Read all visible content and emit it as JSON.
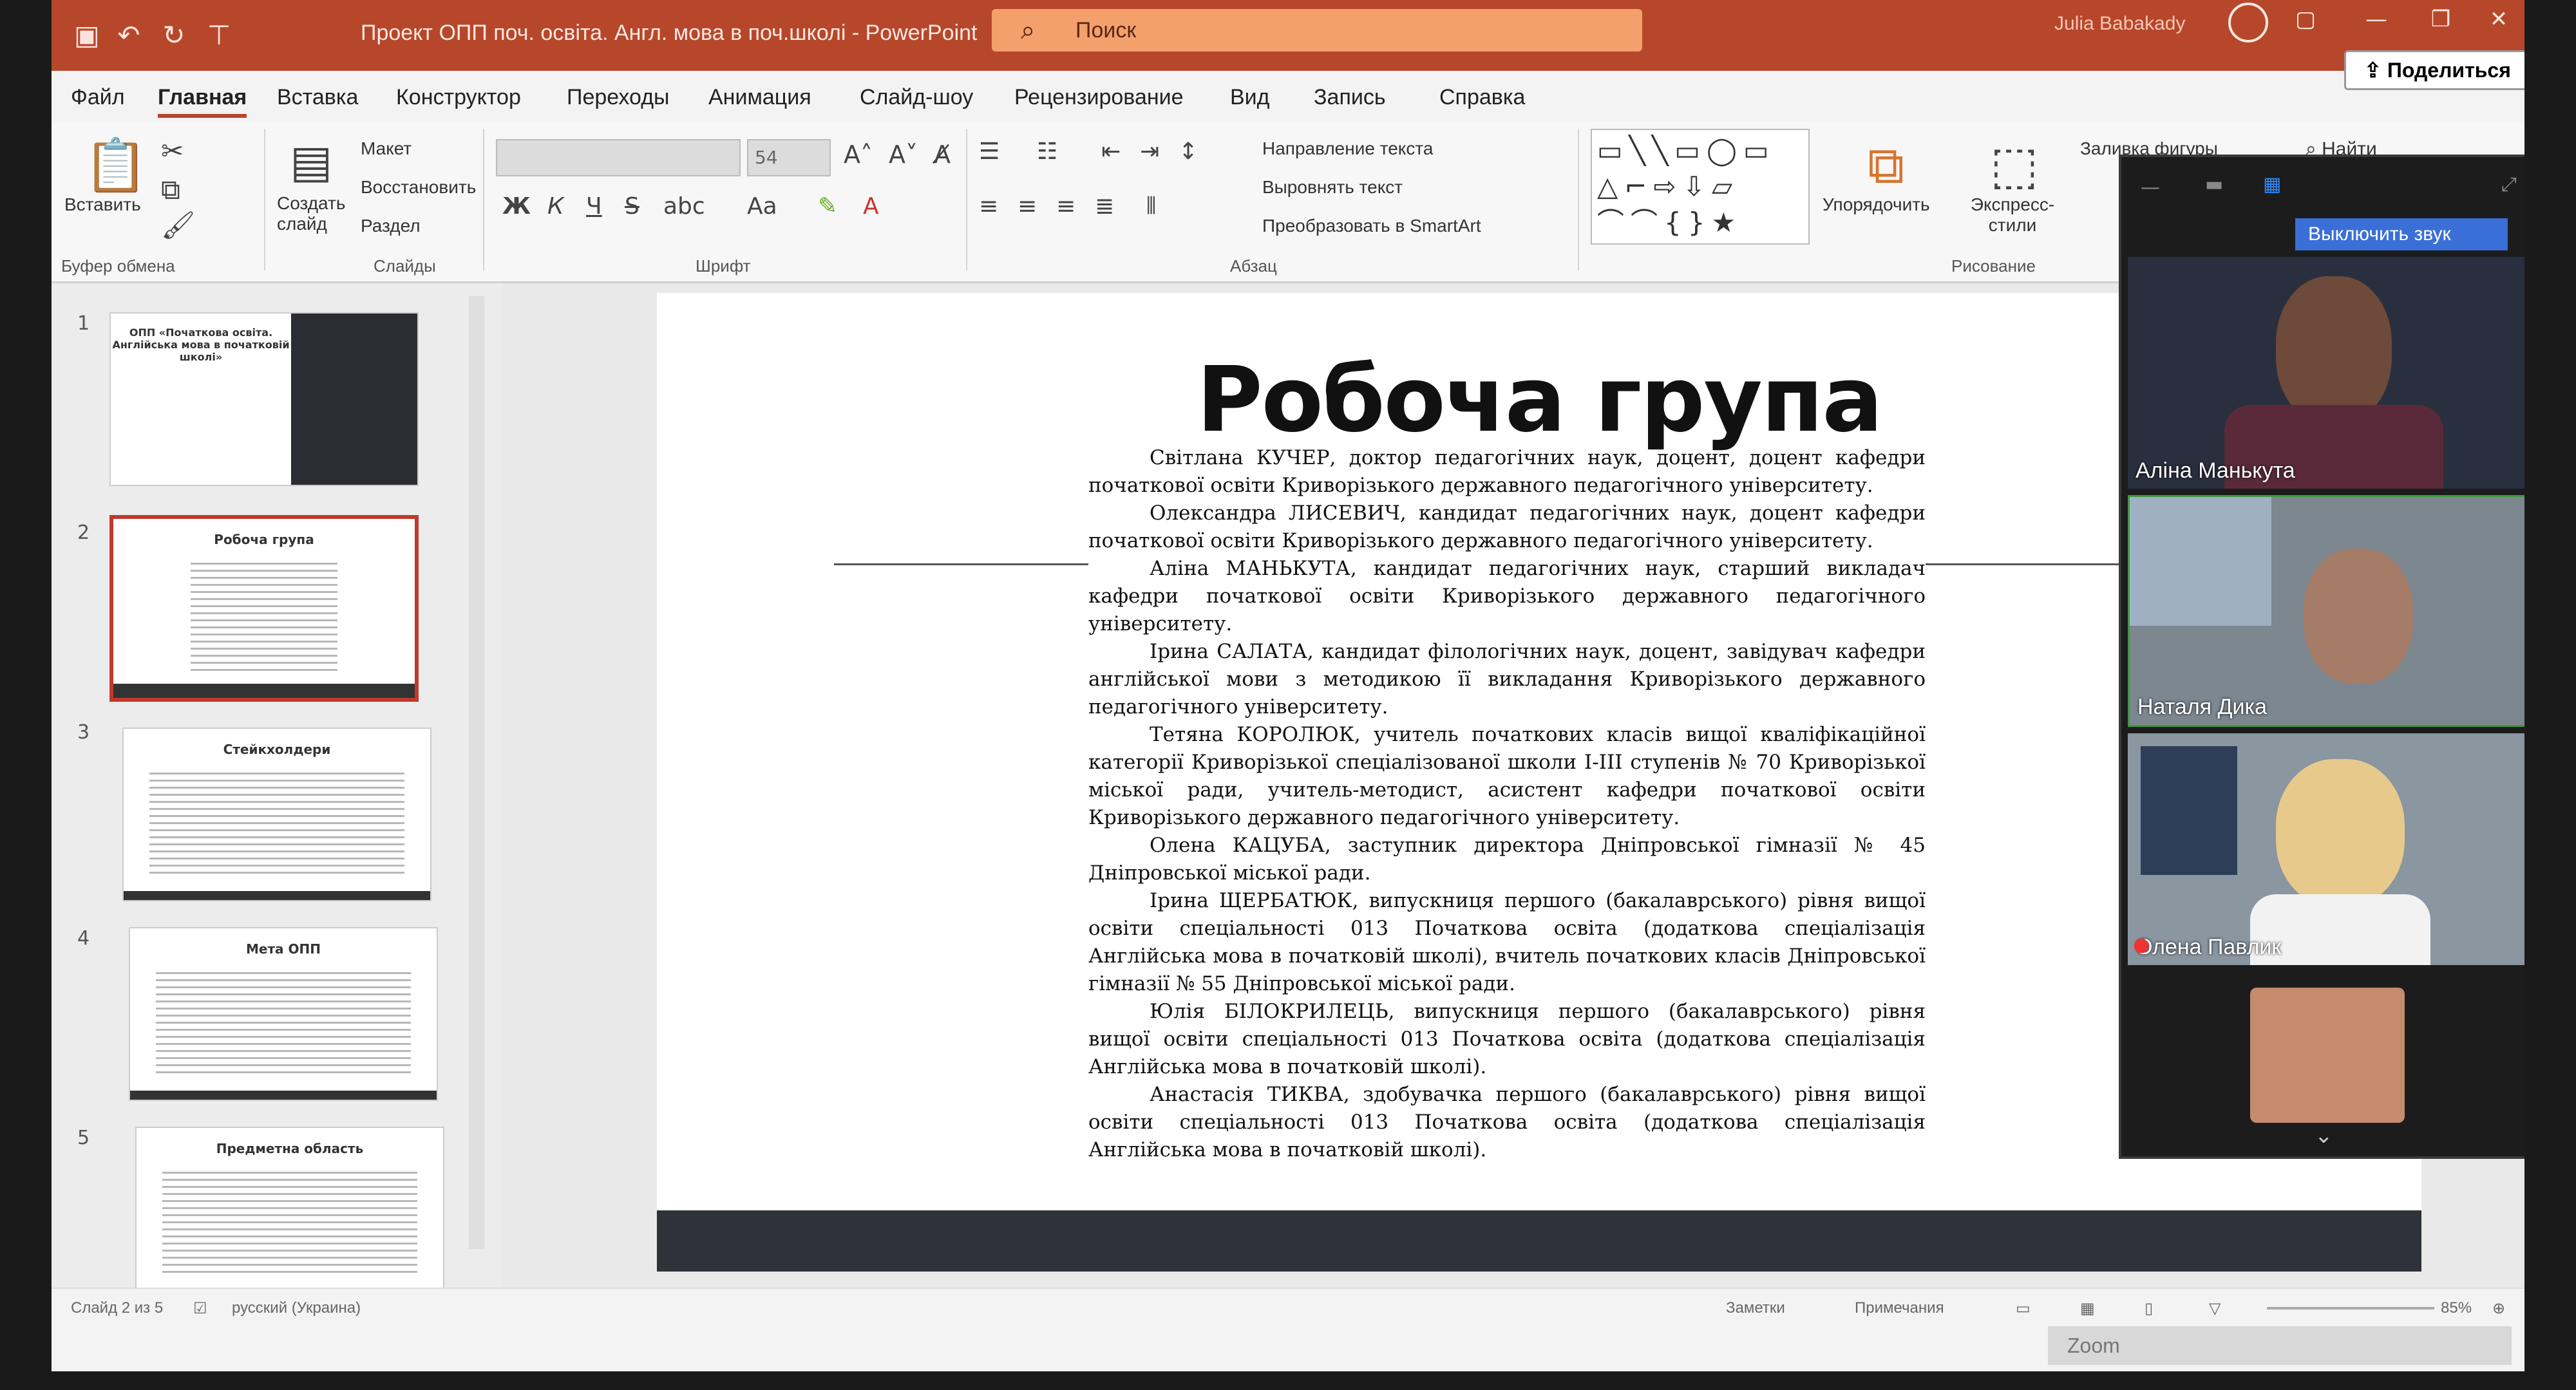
{
  "titlebar": {
    "doc_title": "Проект ОПП поч. освіта. Англ. мова в поч.школі  -  PowerPoint",
    "search_placeholder": "Поиск",
    "user_name": "Julia Babakady"
  },
  "tabs": [
    "Файл",
    "Главная",
    "Вставка",
    "Конструктор",
    "Переходы",
    "Анимация",
    "Слайд-шоу",
    "Рецензирование",
    "Вид",
    "Запись",
    "Справка"
  ],
  "active_tab": "Главная",
  "share_label": "Поделиться",
  "ribbon": {
    "paste": "Вставить",
    "clipboard_group": "Буфер обмена",
    "new_slide": "Создать слайд",
    "layout": "Макет",
    "reset": "Восстановить",
    "section": "Раздел",
    "slides_group": "Слайды",
    "font_size": "54",
    "font_group": "Шрифт",
    "bold": "Ж",
    "italic": "К",
    "underline": "Ч",
    "strike": "S",
    "case": "Aa",
    "text_direction": "Направление текста",
    "align_text": "Выровнять текст",
    "convert_smartart": "Преобразовать в SmartArt",
    "paragraph_group": "Абзац",
    "arrange": "Упорядочить",
    "quick_styles": "Экспресс-стили",
    "shape_fill": "Заливка фигуры",
    "drawing_group": "Рисование",
    "find": "Найти"
  },
  "thumbnails": [
    {
      "num": "1",
      "title": "ОПП «Початкова освіта. Англійська мова в початковій школі»"
    },
    {
      "num": "2",
      "title": "Робоча група"
    },
    {
      "num": "3",
      "title": "Стейкхолдери"
    },
    {
      "num": "4",
      "title": "Мета ОПП"
    },
    {
      "num": "5",
      "title": "Предметна область"
    }
  ],
  "slide": {
    "title": "Робоча група",
    "members": [
      "Світлана КУЧЕР, доктор педагогічних наук, доцент, доцент кафедри початкової освіти Криворізького державного педагогічного університету.",
      "Олександра ЛИСЕВИЧ, кандидат педагогічних наук, доцент кафедри початкової освіти Криворізького державного педагогічного університету.",
      "Аліна МАНЬКУТА, кандидат педагогічних наук, старший викладач кафедри початкової освіти Криворізького державного педагогічного університету.",
      "Ірина САЛАТА, кандидат філологічних наук, доцент, завідувач кафедри англійської мови з методикою її викладання Криворізького державного педагогічного університету.",
      "Тетяна КОРОЛЮК, учитель початкових класів вищої кваліфікаційної категорії Криворізької спеціалізованої школи І-ІІІ ступенів № 70 Криворізької міської ради, учитель-методист, асистент кафедри початкової освіти Криворізького державного педагогічного університету.",
      "Олена КАЦУБА, заступник директора Дніпровської гімназії № 45 Дніпровської міської ради.",
      "Ірина ЩЕРБАТЮК, випускниця першого (бакалаврського) рівня вищої освіти спеціальності 013 Початкова освіта (додаткова спеціалізація Англійська мова в початковій школі), вчитель початкових класів Дніпровської гімназії № 55 Дніпровської міської ради.",
      "Юлія БІЛОКРИЛЕЦЬ, випускниця першого (бакалаврського) рівня вищої освіти спеціальності 013 Початкова освіта (додаткова спеціалізація Англійська мова в початковій школі).",
      "Анастасія ТИКВА, здобувачка першого (бакалаврського) рівня вищої освіти спеціальності 013 Початкова освіта (додаткова спеціалізація Англійська мова в початковій школі)."
    ]
  },
  "statusbar": {
    "slide_counter": "Слайд 2 из 5",
    "language": "русский (Украина)",
    "notes": "Заметки",
    "comments": "Примечания",
    "zoom": "85%"
  },
  "zoom_meeting": {
    "mute_label": "Выключить звук",
    "participants": [
      "Аліна Манькута",
      "Наталя Дика",
      "Олена Павлик"
    ],
    "footer": "Zoom"
  }
}
